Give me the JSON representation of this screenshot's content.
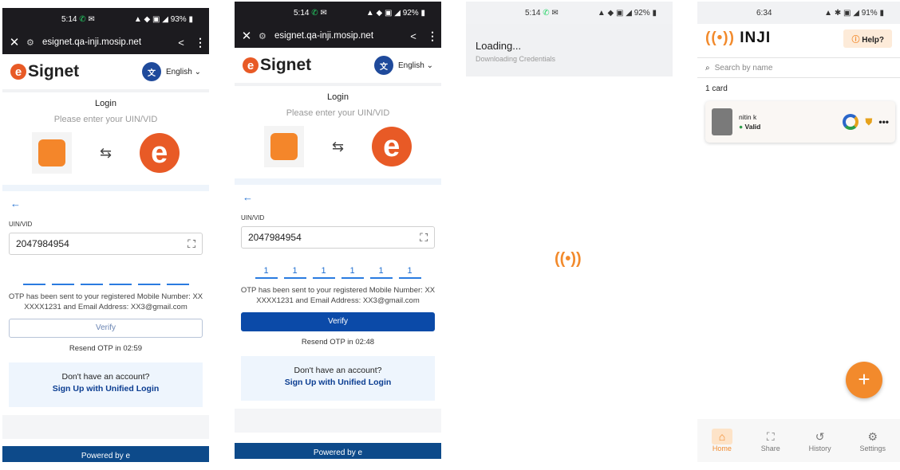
{
  "panel1": {
    "status": {
      "time": "5:14",
      "battery": "93%"
    },
    "url": "esignet.qa-inji.mosip.net",
    "brand": "Signet",
    "language": "English",
    "login_title": "Login",
    "login_sub": "Please enter your UIN/VID",
    "field_label": "UIN/VID",
    "uin": "2047984954",
    "otp": [
      "",
      "",
      "",
      "",
      "",
      ""
    ],
    "otp_message": "OTP has been sent to your registered Mobile Number: XX XXXX1231 and Email Address: XX3@gmail.com",
    "verify": "Verify",
    "resend": "Resend OTP in 02:59",
    "no_account": "Don't have an account?",
    "signup": "Sign Up with Unified Login",
    "powered": "Powered by"
  },
  "panel2": {
    "status": {
      "time": "5:14",
      "battery": "92%"
    },
    "url": "esignet.qa-inji.mosip.net",
    "brand": "Signet",
    "language": "English",
    "login_title": "Login",
    "login_sub": "Please enter your UIN/VID",
    "field_label": "UIN/VID",
    "uin": "2047984954",
    "otp": [
      "1",
      "1",
      "1",
      "1",
      "1",
      "1"
    ],
    "otp_message": "OTP has been sent to your registered Mobile Number: XX XXXX1231 and Email Address: XX3@gmail.com",
    "verify": "Verify",
    "resend": "Resend OTP in 02:48",
    "no_account": "Don't have an account?",
    "signup": "Sign Up with Unified Login",
    "powered": "Powered by"
  },
  "panel3": {
    "status": {
      "time": "5:14",
      "battery": "92%"
    },
    "loading": "Loading...",
    "loading_sub": "Downloading Credentials"
  },
  "panel4": {
    "status": {
      "time": "6:34",
      "battery": "91%"
    },
    "logo": "INJI",
    "help": "Help?",
    "search_placeholder": "Search by name",
    "count": "1 card",
    "card_name": "nitin k",
    "card_status": "Valid",
    "nav": [
      "Home",
      "Share",
      "History",
      "Settings"
    ]
  }
}
